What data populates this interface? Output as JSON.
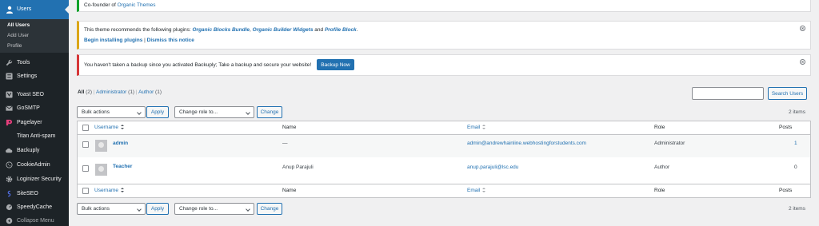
{
  "sidebar": {
    "current": "Users",
    "submenu": [
      "All Users",
      "Add User",
      "Profile"
    ],
    "items": [
      {
        "label": "Tools",
        "icon": "wrench-icon"
      },
      {
        "label": "Settings",
        "icon": "settings-icon"
      },
      {
        "label": "Yoast SEO",
        "icon": "yoast-icon"
      },
      {
        "label": "GoSMTP",
        "icon": "mail-icon"
      },
      {
        "label": "Pagelayer",
        "icon": "pagelayer-icon"
      },
      {
        "label": "Titan Anti-spam",
        "icon": ""
      },
      {
        "label": "Backuply",
        "icon": "cloud-icon"
      },
      {
        "label": "CookieAdmin",
        "icon": "cookie-icon"
      },
      {
        "label": "Loginizer Security",
        "icon": "gear-icon"
      },
      {
        "label": "SiteSEO",
        "icon": "siteseo-icon"
      },
      {
        "label": "SpeedyCache",
        "icon": "speed-icon"
      },
      {
        "label": "Collapse Menu",
        "icon": "collapse-icon"
      }
    ],
    "colors": {
      "bg": "#1d2327",
      "current": "#2271b1",
      "pagelayer": "#e43e7b"
    }
  },
  "notices": {
    "cofounder": {
      "prefix": "Co-founder of",
      "link": "Organic Themes"
    },
    "plugins": {
      "text": "This theme recommends the following plugins:",
      "plugin1": "Organic Blocks Bundle",
      "sep1": ",",
      "plugin2": "Organic Builder Widgets",
      "and": "and",
      "plugin3": "Profile Block",
      "end": ".",
      "begin": "Begin installing plugins",
      "pipe": "|",
      "dismiss": "Dismiss this notice"
    },
    "backup": {
      "text": "You haven't taken a backup since you activated Backuply; Take a backup and secure your website!",
      "button": "Backup Now"
    }
  },
  "filters": {
    "all": "All",
    "all_count": "(2)",
    "sep": "|",
    "administrator": "Administrator",
    "administrator_count": "(1)",
    "author": "Author",
    "author_count": "(1)"
  },
  "search": {
    "value": "",
    "button": "Search Users"
  },
  "bulk": {
    "select": "Bulk actions",
    "apply": "Apply",
    "role": "Change role to...",
    "change": "Change"
  },
  "count": "2 items",
  "table": {
    "headers": {
      "username": "Username",
      "name": "Name",
      "email": "Email",
      "role": "Role",
      "posts": "Posts"
    },
    "rows": [
      {
        "username": "admin",
        "name": "—",
        "email": "admin@andrewhainline.webhostingforstudents.com",
        "role": "Administrator",
        "posts": "1"
      },
      {
        "username": "Teacher",
        "name": "Anup Parajuli",
        "email": "anup.parajuli@lsc.edu",
        "role": "Author",
        "posts": "0"
      }
    ]
  },
  "colors": {
    "accent": "#2271b1",
    "notice_success": "#00a32a",
    "notice_warning": "#dba617",
    "notice_error": "#d63638"
  }
}
